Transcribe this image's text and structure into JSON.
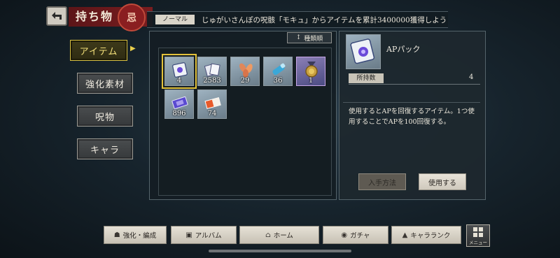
{
  "header": {
    "title": "持ち物",
    "emblem_char": "忌",
    "mission_tag": "ノーマル",
    "mission_text": "じゅがいさんぽの呪骸「モキュ」からアイテムを累計3400000獲得しよう"
  },
  "tabs": [
    {
      "label": "アイテム",
      "active": true
    },
    {
      "label": "強化素材",
      "active": false
    },
    {
      "label": "呪物",
      "active": false
    },
    {
      "label": "キャラ",
      "active": false
    }
  ],
  "sort": {
    "label": "種類順",
    "icon": "sort-icon"
  },
  "items": [
    {
      "name": "APパック",
      "count": "4",
      "icon": "ap-pack-icon",
      "selected": true
    },
    {
      "name": "cards",
      "count": "2583",
      "icon": "card-stack-icon",
      "selected": false
    },
    {
      "name": "petals",
      "count": "29",
      "icon": "petals-icon",
      "selected": false
    },
    {
      "name": "scroll",
      "count": "36",
      "icon": "scroll-icon",
      "selected": false
    },
    {
      "name": "medal",
      "count": "1",
      "icon": "medal-icon",
      "selected": false
    },
    {
      "name": "ticket",
      "count": "896",
      "icon": "ticket-icon",
      "selected": false
    },
    {
      "name": "red-ticket",
      "count": "74",
      "icon": "red-ticket-icon",
      "selected": false
    }
  ],
  "detail": {
    "name": "APパック",
    "owned_label": "所持数",
    "owned_count": "4",
    "description": "使用するとAPを回復するアイテム。1つ使用することでAPを100回復する。",
    "acquire_label": "入手方法",
    "use_label": "使用する"
  },
  "nav": [
    {
      "label": "強化・編成",
      "icon": "team-icon"
    },
    {
      "label": "アルバム",
      "icon": "album-icon"
    },
    {
      "label": "ホーム",
      "icon": "home-icon"
    },
    {
      "label": "ガチャ",
      "icon": "gacha-icon"
    },
    {
      "label": "キャラランク",
      "icon": "rank-icon"
    }
  ],
  "menu_label": "メニュー"
}
